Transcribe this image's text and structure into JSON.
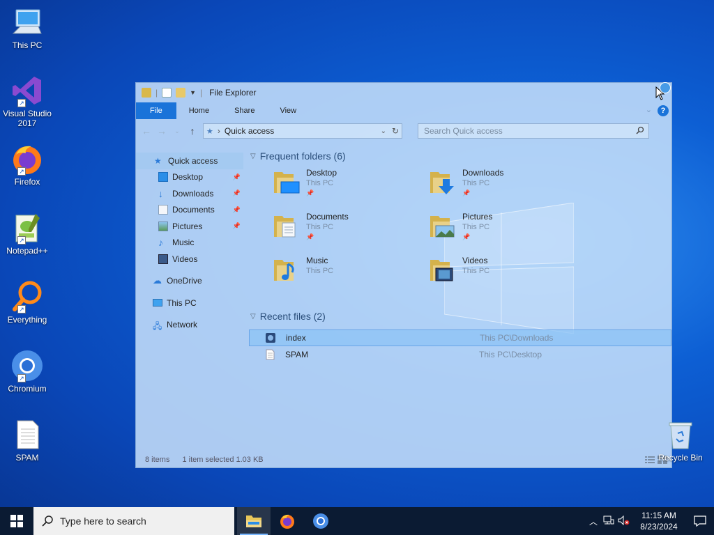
{
  "desktop": {
    "icons": [
      {
        "label": "This PC",
        "icon": "this-pc-icon"
      },
      {
        "label": "Visual Studio 2017",
        "icon": "visual-studio-icon"
      },
      {
        "label": "Firefox",
        "icon": "firefox-icon"
      },
      {
        "label": "Notepad++",
        "icon": "notepadpp-icon"
      },
      {
        "label": "Everything",
        "icon": "everything-search-icon"
      },
      {
        "label": "Chromium",
        "icon": "chromium-icon"
      },
      {
        "label": "SPAM",
        "icon": "text-file-icon"
      }
    ],
    "recycle_bin": {
      "label": "Recycle Bin",
      "icon": "recycle-bin-icon"
    }
  },
  "explorer": {
    "title": "File Explorer",
    "ribbon_tabs": [
      "File",
      "Home",
      "Share",
      "View"
    ],
    "address": {
      "location": "Quick access"
    },
    "search": {
      "placeholder": "Search Quick access"
    },
    "nav_pane": {
      "quick_access": "Quick access",
      "pinned": [
        "Desktop",
        "Downloads",
        "Documents",
        "Pictures"
      ],
      "unpinned": [
        "Music",
        "Videos"
      ],
      "onedrive": "OneDrive",
      "this_pc": "This PC",
      "network": "Network"
    },
    "frequent_folders": {
      "heading": "Frequent folders (6)",
      "items": [
        {
          "name": "Desktop",
          "location": "This PC"
        },
        {
          "name": "Downloads",
          "location": "This PC"
        },
        {
          "name": "Documents",
          "location": "This PC"
        },
        {
          "name": "Pictures",
          "location": "This PC"
        },
        {
          "name": "Music",
          "location": "This PC"
        },
        {
          "name": "Videos",
          "location": "This PC"
        }
      ]
    },
    "recent_files": {
      "heading": "Recent files (2)",
      "items": [
        {
          "name": "index",
          "path": "This PC\\Downloads",
          "selected": true
        },
        {
          "name": "SPAM",
          "path": "This PC\\Desktop",
          "selected": false
        }
      ]
    },
    "status": {
      "count": "8 items",
      "selection": "1 item selected  1.03 KB"
    }
  },
  "taskbar": {
    "search_placeholder": "Type here to search",
    "apps": [
      "file-explorer-icon",
      "firefox-icon",
      "chromium-icon"
    ],
    "clock": {
      "time": "11:15 AM",
      "date": "8/23/2024"
    }
  },
  "colors": {
    "accent": "#1a73d9",
    "taskbar": "#0b1b33",
    "folder": "#e8c75a"
  }
}
